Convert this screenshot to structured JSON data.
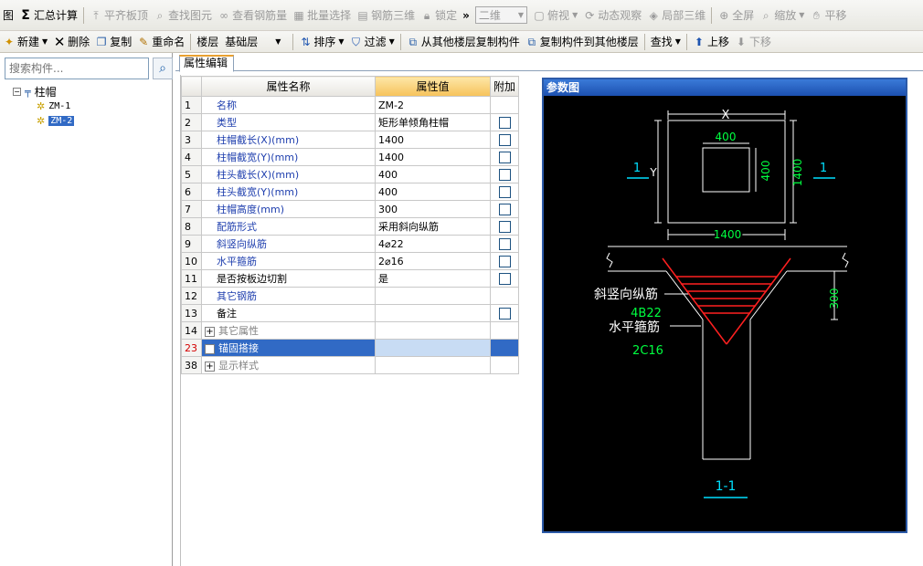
{
  "toolbar1": {
    "items": [
      {
        "label": "图",
        "disabled": false
      },
      {
        "label": "汇总计算",
        "disabled": false
      },
      {
        "label": "平齐板顶",
        "disabled": true
      },
      {
        "label": "查找图元",
        "disabled": true
      },
      {
        "label": "查看钢筋量",
        "disabled": true
      },
      {
        "label": "批量选择",
        "disabled": true
      },
      {
        "label": "钢筋三维",
        "disabled": true
      },
      {
        "label": "锁定",
        "disabled": true
      }
    ],
    "overflow": "»",
    "view_mode": "二维",
    "view_items": [
      "俯视",
      "动态观察",
      "局部三维",
      "全屏",
      "缩放",
      "平移"
    ],
    "sum_symbol": "Σ"
  },
  "toolbar2": {
    "new": "新建",
    "delete": "删除",
    "copy": "复制",
    "rename": "重命名",
    "floor_label": "楼层",
    "floor_value": "基础层",
    "sort": "排序",
    "filter": "过滤",
    "copy_from": "从其他楼层复制构件",
    "copy_to": "复制构件到其他楼层",
    "find": "查找",
    "move_up": "上移",
    "move_down": "下移"
  },
  "left_panel": {
    "search_placeholder": "搜索构件...",
    "tree": {
      "root": "柱帽",
      "children": [
        "ZM-1",
        "ZM-2"
      ]
    }
  },
  "tab": "属性编辑",
  "table": {
    "headers": [
      "属性名称",
      "属性值",
      "附加"
    ],
    "rows": [
      {
        "n": "1",
        "name": "名称",
        "value": "ZM-2",
        "check": false,
        "style": "blue"
      },
      {
        "n": "2",
        "name": "类型",
        "value": "矩形单倾角柱帽",
        "check": true,
        "style": "blue"
      },
      {
        "n": "3",
        "name": "柱帽截长(X)(mm)",
        "value": "1400",
        "check": true,
        "style": "blue"
      },
      {
        "n": "4",
        "name": "柱帽截宽(Y)(mm)",
        "value": "1400",
        "check": true,
        "style": "blue"
      },
      {
        "n": "5",
        "name": "柱头截长(X)(mm)",
        "value": "400",
        "check": true,
        "style": "blue"
      },
      {
        "n": "6",
        "name": "柱头截宽(Y)(mm)",
        "value": "400",
        "check": true,
        "style": "blue"
      },
      {
        "n": "7",
        "name": "柱帽高度(mm)",
        "value": "300",
        "check": true,
        "style": "blue"
      },
      {
        "n": "8",
        "name": "配筋形式",
        "value": "采用斜向纵筋",
        "check": true,
        "style": "blue"
      },
      {
        "n": "9",
        "name": "斜竖向纵筋",
        "value": "4⌀22",
        "check": true,
        "style": "blue"
      },
      {
        "n": "10",
        "name": "水平箍筋",
        "value": "2⌀16",
        "check": true,
        "style": "blue"
      },
      {
        "n": "11",
        "name": "是否按板边切割",
        "value": "是",
        "check": true,
        "style": "black"
      },
      {
        "n": "12",
        "name": "其它钢筋",
        "value": "",
        "check": false,
        "style": "blue"
      },
      {
        "n": "13",
        "name": "备注",
        "value": "",
        "check": true,
        "style": "black"
      },
      {
        "n": "14",
        "name": "其它属性",
        "value": "",
        "check": false,
        "style": "group"
      },
      {
        "n": "23",
        "name": "锚固搭接",
        "value": "",
        "check": false,
        "style": "selected"
      },
      {
        "n": "38",
        "name": "显示样式",
        "value": "",
        "check": false,
        "style": "group"
      }
    ]
  },
  "diagram": {
    "title": "参数图",
    "labels": {
      "x": "X",
      "y": "Y",
      "head_w": "400",
      "head_h": "400",
      "cap_h": "1400",
      "cap_w": "1400",
      "sec_left": "1",
      "sec_right": "1",
      "rebar_label": "斜竖向纵筋",
      "rebar_value": "4B22",
      "stirrup_label": "水平箍筋",
      "stirrup_value": "2C16",
      "height": "300",
      "section": "1-1"
    }
  }
}
